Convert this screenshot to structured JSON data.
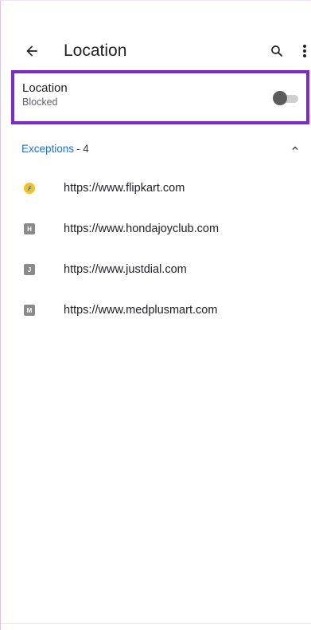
{
  "appbar": {
    "title": "Location",
    "icons": {
      "back": "back-arrow-icon",
      "search": "search-icon",
      "more": "more-vert-icon"
    }
  },
  "setting": {
    "title": "Location",
    "subtitle": "Blocked",
    "toggle_on": false
  },
  "exceptions": {
    "label": "Exceptions",
    "count_text": "- 4",
    "expanded": true
  },
  "sites": [
    {
      "url": "https://www.flipkart.com",
      "favicon": "flipkart-icon",
      "letter": ""
    },
    {
      "url": "https://www.hondajoyclub.com",
      "favicon": "letter-h-icon",
      "letter": "H"
    },
    {
      "url": "https://www.justdial.com",
      "favicon": "letter-j-icon",
      "letter": "J"
    },
    {
      "url": "https://www.medplusmart.com",
      "favicon": "letter-m-icon",
      "letter": "M"
    }
  ],
  "colors": {
    "accent": "#1a73e8",
    "highlight": "#7b2ad1",
    "toggle_thumb": "#5c5c5c",
    "toggle_track": "#cfcfcf",
    "favicon_letter_bg": "#8a8a8a",
    "flipkart_yellow": "#f7c21b",
    "flipkart_blue": "#2874f0"
  }
}
